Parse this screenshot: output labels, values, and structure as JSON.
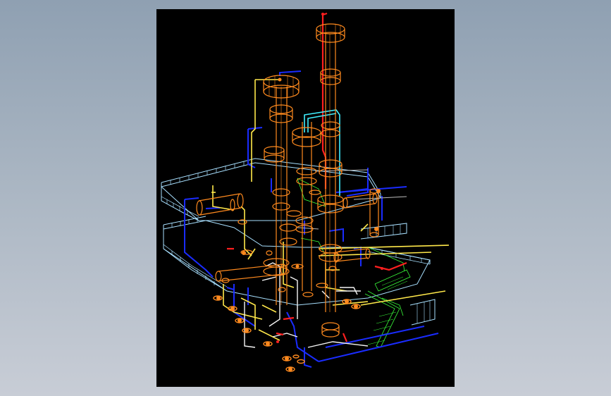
{
  "scene": {
    "subject": "",
    "viewport_background": "#000000",
    "colors": {
      "equipment": "#ff8a1e",
      "railing": "#a8e0ff",
      "pipe_yellow": "#ffe84a",
      "pipe_blue": "#1a2cff",
      "pipe_red": "#ff1f1f",
      "pipe_white": "#f4f4f4",
      "pipe_cyan": "#40f0ff",
      "pipe_green": "#3aff3a",
      "pipe_gray": "#bdbdbd"
    }
  }
}
